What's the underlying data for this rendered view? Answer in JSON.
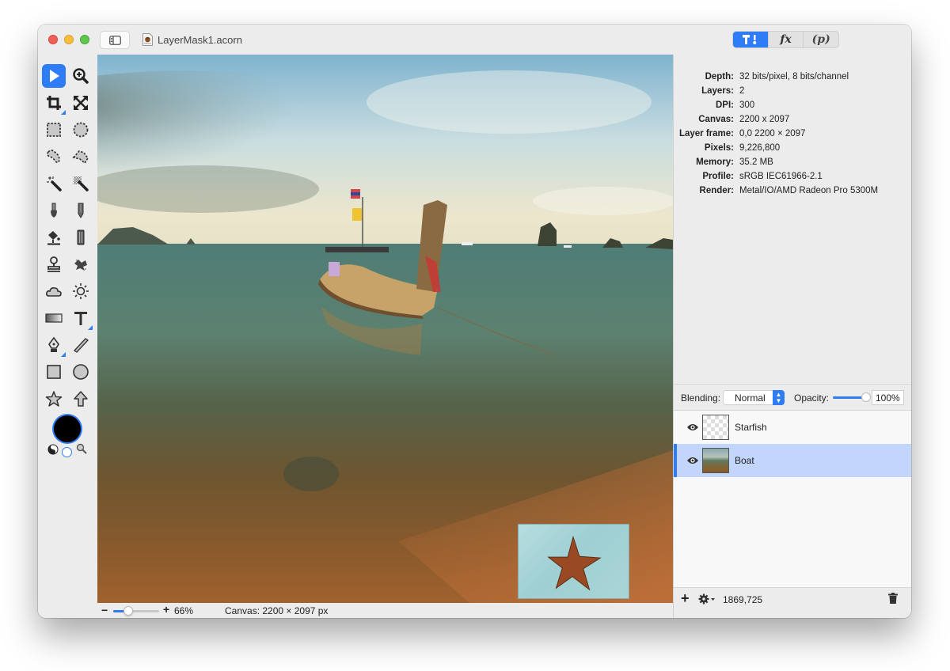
{
  "window": {
    "title": "LayerMask1.acorn",
    "icons": {
      "close": "close-dot",
      "minimize": "minimize-dot",
      "maximize": "maximize-dot",
      "sidebar_toggle": "sidebar-icon",
      "document": "acorn-document-icon"
    }
  },
  "inspector_tabs": [
    {
      "id": "tools",
      "label": "",
      "icon": "hammer-brush-icon",
      "active": true
    },
    {
      "id": "fx",
      "label": "fx",
      "active": false
    },
    {
      "id": "properties",
      "label": "(p)",
      "active": false
    }
  ],
  "toolbox": {
    "tools": [
      {
        "name": "select",
        "icon": "arrow-cursor-icon",
        "selected": true
      },
      {
        "name": "zoom",
        "icon": "zoom-in-icon"
      },
      {
        "name": "crop",
        "icon": "crop-icon",
        "has_submenu": true
      },
      {
        "name": "transform",
        "icon": "expand-arrows-icon"
      },
      {
        "name": "rect-select",
        "icon": "rect-marquee-icon"
      },
      {
        "name": "ellipse-select",
        "icon": "ellipse-marquee-icon"
      },
      {
        "name": "lasso",
        "icon": "lasso-icon"
      },
      {
        "name": "polygon-lasso",
        "icon": "polygon-lasso-icon"
      },
      {
        "name": "magic-wand",
        "icon": "magic-wand-icon"
      },
      {
        "name": "instant-alpha",
        "icon": "instant-alpha-icon"
      },
      {
        "name": "brush",
        "icon": "brush-icon"
      },
      {
        "name": "pencil",
        "icon": "pencil-icon"
      },
      {
        "name": "paint-bucket",
        "icon": "paint-bucket-icon"
      },
      {
        "name": "eraser",
        "icon": "eraser-icon"
      },
      {
        "name": "clone",
        "icon": "clone-stamp-icon"
      },
      {
        "name": "smudge",
        "icon": "smudge-icon"
      },
      {
        "name": "burn",
        "icon": "cloud-icon"
      },
      {
        "name": "dodge",
        "icon": "sun-icon"
      },
      {
        "name": "gradient",
        "icon": "gradient-icon"
      },
      {
        "name": "text",
        "icon": "text-icon",
        "has_submenu": true
      },
      {
        "name": "bezier",
        "icon": "pen-nib-icon",
        "has_submenu": true
      },
      {
        "name": "line",
        "icon": "line-icon"
      },
      {
        "name": "rectangle",
        "icon": "rectangle-shape-icon"
      },
      {
        "name": "oval",
        "icon": "oval-shape-icon"
      },
      {
        "name": "star",
        "icon": "star-shape-icon"
      },
      {
        "name": "arrow",
        "icon": "arrow-shape-icon"
      }
    ],
    "foreground_color": "#000000",
    "background_color": "#ffffff"
  },
  "canvas": {
    "layers_shown": [
      "Boat",
      "Starfish"
    ]
  },
  "statusbar": {
    "zoom_minus": "−",
    "zoom_plus": "+",
    "zoom_level_percent": 66,
    "zoom_slider_fraction": 0.33,
    "zoom_label": "66%",
    "canvas_size": "Canvas: 2200 × 2097 px"
  },
  "info": [
    {
      "key": "Depth:",
      "value": "32 bits/pixel, 8 bits/channel"
    },
    {
      "key": "Layers:",
      "value": "2"
    },
    {
      "key": "DPI:",
      "value": "300"
    },
    {
      "key": "Canvas:",
      "value": "2200 x 2097"
    },
    {
      "key": "Layer frame:",
      "value": "0,0 2200 × 2097"
    },
    {
      "key": "Pixels:",
      "value": "9,226,800"
    },
    {
      "key": "Memory:",
      "value": "35.2 MB"
    },
    {
      "key": "Profile:",
      "value": "sRGB IEC61966-2.1"
    },
    {
      "key": "Render:",
      "value": "Metal/IO/AMD Radeon Pro 5300M"
    }
  ],
  "blending": {
    "label": "Blending:",
    "mode": "Normal",
    "opacity_label": "Opacity:",
    "opacity_value": "100%",
    "opacity_fraction": 1.0
  },
  "layers": [
    {
      "name": "Starfish",
      "visible": true,
      "selected": false,
      "thumb": "checker"
    },
    {
      "name": "Boat",
      "visible": true,
      "selected": true,
      "thumb": "boat"
    }
  ],
  "layers_footer": {
    "add": "+",
    "coords": "1869,725",
    "icons": {
      "add": "plus-icon",
      "gear": "gear-icon",
      "trash": "trash-icon"
    }
  },
  "colors": {
    "accent": "#2e7cf6",
    "selection": "#c2d6fb",
    "window_bg": "#ececec"
  }
}
